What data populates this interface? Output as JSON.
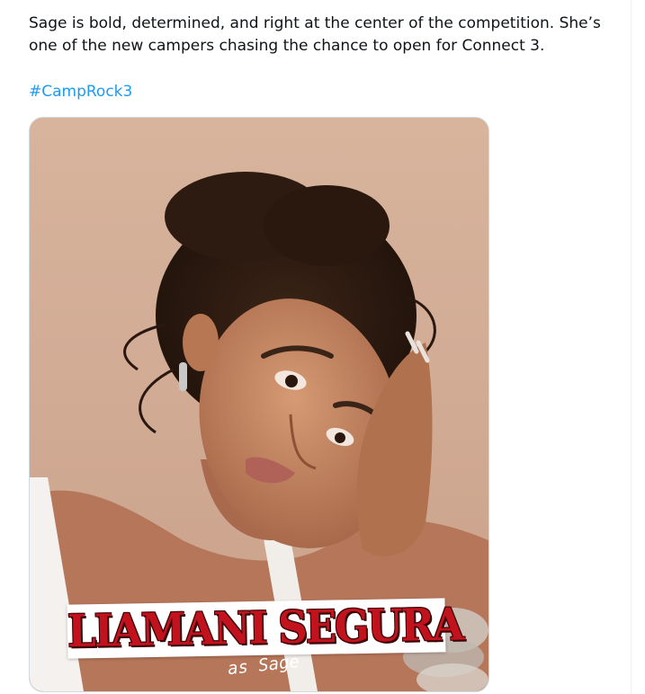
{
  "tweet": {
    "text_line1": "Sage is bold, determined, and right at the center of the competition. She’s",
    "text_line2": "one of the new campers chasing the chance to open for Connect 3.",
    "hashtag": "#CampRock3",
    "hashtag_color": "#1d9bf0"
  },
  "media": {
    "caption_name": "LIAMANI SEGURA",
    "caption_role": "as Sage",
    "caption_color": "#c2121d"
  }
}
